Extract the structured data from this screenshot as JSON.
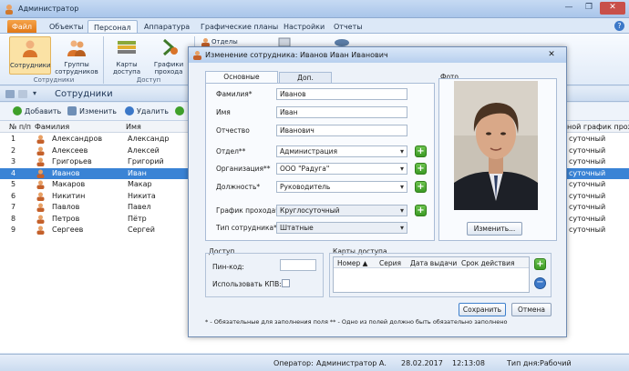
{
  "app": {
    "title": "Администратор"
  },
  "menu_tabs": [
    "Файл",
    "Объекты",
    "Персонал",
    "Аппаратура",
    "Графические планы",
    "Настройки",
    "Отчеты"
  ],
  "ribbon": {
    "staff_label": "Сотрудники",
    "groups_label": "Группы сотрудников",
    "group_staff": "Сотрудники",
    "cards_label": "Карты доступа",
    "schedules_label": "Графики прохода",
    "group_access": "Доступ",
    "departments_label": "Отделы"
  },
  "doc_title": "Сотрудники",
  "toolbar": {
    "add": "Добавить",
    "edit": "Изменить",
    "delete": "Удалить"
  },
  "table": {
    "headers": [
      "№ п/п",
      "Фамилия",
      "Имя",
      "ной график прохо..."
    ],
    "rows": [
      {
        "n": "1",
        "last": "Александров",
        "first": "Александр",
        "sched": "суточный"
      },
      {
        "n": "2",
        "last": "Алексеев",
        "first": "Алексей",
        "sched": "суточный"
      },
      {
        "n": "3",
        "last": "Григорьев",
        "first": "Григорий",
        "sched": "суточный"
      },
      {
        "n": "4",
        "last": "Иванов",
        "first": "Иван",
        "sched": "суточный"
      },
      {
        "n": "5",
        "last": "Макаров",
        "first": "Макар",
        "sched": "суточный"
      },
      {
        "n": "6",
        "last": "Никитин",
        "first": "Никита",
        "sched": "суточный"
      },
      {
        "n": "7",
        "last": "Павлов",
        "first": "Павел",
        "sched": "суточный"
      },
      {
        "n": "8",
        "last": "Петров",
        "first": "Пётр",
        "sched": "суточный"
      },
      {
        "n": "9",
        "last": "Сергеев",
        "first": "Сергей",
        "sched": "суточный"
      }
    ]
  },
  "dialog": {
    "title": "Изменение сотрудника: Иванов Иван Иванович",
    "tab_main": "Основные сведения",
    "tab_extra": "Доп. сведения",
    "photo_label": "Фото",
    "change_photo": "Изменить...",
    "fields": {
      "lastname_label": "Фамилия*",
      "lastname": "Иванов",
      "firstname_label": "Имя",
      "firstname": "Иван",
      "middlename_label": "Отчество",
      "middlename": "Иванович",
      "dept_label": "Отдел**",
      "dept": "Администрация",
      "org_label": "Организация**",
      "org": "ООО \"Радуга\"",
      "position_label": "Должность*",
      "position": "Руководитель",
      "schedule_label": "График прохода*",
      "schedule": "Круглосуточный",
      "type_label": "Тип сотрудника*",
      "type": "Штатные"
    },
    "access": {
      "title": "Доступ",
      "pin_label": "Пин-код:",
      "pin": "",
      "kpv_label": "Использовать КПВ:"
    },
    "cards": {
      "title": "Карты доступа",
      "headers": [
        "Номер",
        "Серия",
        "Дата выдачи",
        "Срок действия"
      ]
    },
    "save": "Сохранить",
    "cancel": "Отмена",
    "footnote": "* - Обязательные для заполнения поля  ** - Одно из полей должно быть обязательно заполнено"
  },
  "status": {
    "operator_label": "Оператор:",
    "operator": "Администратор А.",
    "date": "28.02.2017",
    "time": "12:13:08",
    "day_label": "Тип дня:",
    "day": "Рабочий"
  }
}
